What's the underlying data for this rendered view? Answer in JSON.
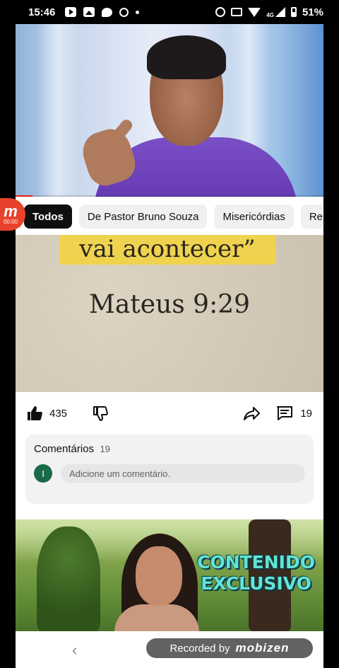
{
  "status_bar": {
    "time": "15:46",
    "network_label": "4G",
    "battery": "51%"
  },
  "chips": [
    {
      "label": "Todos",
      "active": true
    },
    {
      "label": "De Pastor Bruno Souza",
      "active": false
    },
    {
      "label": "Misericórdias",
      "active": false
    },
    {
      "label": "Rela",
      "active": false
    }
  ],
  "video2": {
    "quote_text": "vai acontecer”",
    "verse_text": "Mateus 9:29"
  },
  "mobizen_badge": {
    "letter": "m",
    "timer": "00:00"
  },
  "actions": {
    "like_count": "435",
    "comment_count": "19"
  },
  "comments": {
    "title": "Comentários",
    "count": "19",
    "avatar_letter": "I",
    "input_placeholder": "Adicione um comentário."
  },
  "video3": {
    "title_line1": "CONTENIDO",
    "title_line2": "EXCLUSIVO"
  },
  "recorder": {
    "prefix": "Recorded by",
    "brand": "mobizen"
  },
  "colors": {
    "accent_red": "#e62117",
    "chip_active_bg": "#0f0f0f",
    "avatar_green": "#1b6a47",
    "exclusive_text": "#63e4d4"
  }
}
